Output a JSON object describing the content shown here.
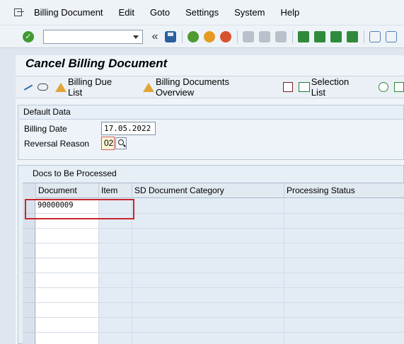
{
  "menu": {
    "items": [
      {
        "label": "Billing Document",
        "key": "B"
      },
      {
        "label": "Edit",
        "key": "E"
      },
      {
        "label": "Goto",
        "key": "G"
      },
      {
        "label": "Settings",
        "key": "S"
      },
      {
        "label": "System",
        "key": "y"
      },
      {
        "label": "Help",
        "key": "H"
      }
    ]
  },
  "toolbar": {
    "command_value": "",
    "collapse_glyph": "«",
    "icons": [
      "enter-icon",
      "save-icon",
      "back-icon",
      "exit-icon",
      "cancel-icon",
      "print-icon",
      "find-icon",
      "find-next-icon",
      "first-page-icon",
      "prev-page-icon",
      "next-page-icon",
      "last-page-icon",
      "new-session-icon",
      "shortcut-icon"
    ]
  },
  "page": {
    "title": "Cancel Billing Document"
  },
  "app_toolbar": {
    "billing_due_list": "Billing Due List",
    "billing_docs_overview": "Billing Documents Overview",
    "selection_list": "Selection List"
  },
  "default_data": {
    "title": "Default Data",
    "billing_date_label": "Billing Date",
    "billing_date_value": "17.05.2022",
    "reversal_reason_label": "Reversal Reason",
    "reversal_reason_value": "02"
  },
  "docs_table": {
    "title": "Docs to Be Processed",
    "columns": [
      "Document",
      "Item",
      "SD Document Category",
      "Processing Status"
    ],
    "rows": [
      [
        "90000009",
        "",
        "",
        ""
      ]
    ]
  },
  "colors": {
    "highlight": "#c8262d",
    "title_bg": "#eff4f9"
  }
}
